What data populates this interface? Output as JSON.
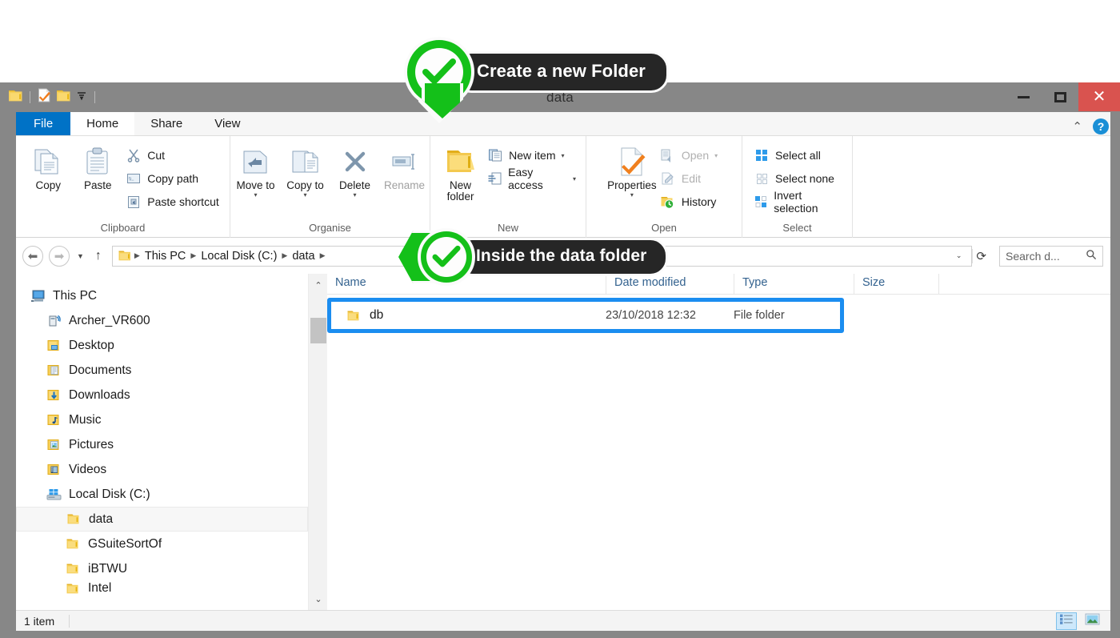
{
  "window": {
    "title": "data",
    "quick_access": [
      "folder-icon",
      "properties-icon",
      "folder-icon",
      "customize-dropdown-icon"
    ],
    "controls": {
      "minimize": "—",
      "maximize": "□",
      "close": "✕"
    }
  },
  "ribbon": {
    "tabs": [
      {
        "label": "File",
        "state": "file"
      },
      {
        "label": "Home",
        "state": "active"
      },
      {
        "label": "Share",
        "state": "normal"
      },
      {
        "label": "View",
        "state": "normal"
      }
    ],
    "collapse_icon": "chevron-up-icon",
    "help_icon": "help-icon",
    "groups": [
      {
        "label": "Clipboard",
        "big_buttons": [
          {
            "label": "Copy",
            "icon": "copy-icon"
          },
          {
            "label": "Paste",
            "icon": "paste-icon"
          }
        ],
        "small_buttons": [
          {
            "label": "Cut",
            "icon": "scissors-icon",
            "disabled": false
          },
          {
            "label": "Copy path",
            "icon": "copy-path-icon",
            "disabled": false
          },
          {
            "label": "Paste shortcut",
            "icon": "paste-shortcut-icon",
            "disabled": false
          }
        ]
      },
      {
        "label": "Organise",
        "big_buttons": [
          {
            "label": "Move to",
            "icon": "move-to-icon",
            "has_caret": true
          },
          {
            "label": "Copy to",
            "icon": "copy-to-icon",
            "has_caret": true
          },
          {
            "label": "Delete",
            "icon": "delete-icon",
            "has_caret": true
          },
          {
            "label": "Rename",
            "icon": "rename-icon",
            "disabled": true
          }
        ],
        "small_buttons": []
      },
      {
        "label": "New",
        "big_buttons": [
          {
            "label": "New folder",
            "icon": "new-folder-icon"
          }
        ],
        "small_buttons": [
          {
            "label": "New item",
            "icon": "new-item-icon",
            "caret": true
          },
          {
            "label": "Easy access",
            "icon": "easy-access-icon",
            "caret": true
          }
        ]
      },
      {
        "label": "Open",
        "big_buttons": [
          {
            "label": "Properties",
            "icon": "properties-icon",
            "has_caret": true
          }
        ],
        "small_buttons": [
          {
            "label": "Open",
            "icon": "open-icon",
            "caret": true,
            "disabled": true
          },
          {
            "label": "Edit",
            "icon": "edit-icon",
            "disabled": true
          },
          {
            "label": "History",
            "icon": "history-icon",
            "disabled": false
          }
        ]
      },
      {
        "label": "Select",
        "big_buttons": [],
        "small_buttons": [
          {
            "label": "Select all",
            "icon": "select-all-icon",
            "disabled": false
          },
          {
            "label": "Select none",
            "icon": "select-none-icon",
            "disabled": false
          },
          {
            "label": "Invert selection",
            "icon": "invert-selection-icon",
            "disabled": false
          }
        ]
      }
    ]
  },
  "address_bar": {
    "back_icon": "back-arrow-icon",
    "forward_icon": "forward-arrow-icon",
    "recent_icon": "chevron-down-icon",
    "up_icon": "up-arrow-icon",
    "breadcrumb_icon": "folder-icon",
    "breadcrumbs": [
      "This PC",
      "Local Disk (C:)",
      "data"
    ],
    "dropdown_icon": "chevron-down-icon",
    "refresh_icon": "refresh-icon",
    "search_placeholder": "Search d...",
    "search_value": "",
    "search_icon": "search-icon"
  },
  "nav_pane": {
    "items": [
      {
        "label": "This PC",
        "icon": "this-pc-icon",
        "depth": 0,
        "selected": false
      },
      {
        "label": "Archer_VR600",
        "icon": "device-icon",
        "depth": 1,
        "selected": false
      },
      {
        "label": "Desktop",
        "icon": "desktop-folder-icon",
        "depth": 1,
        "selected": false
      },
      {
        "label": "Documents",
        "icon": "documents-folder-icon",
        "depth": 1,
        "selected": false
      },
      {
        "label": "Downloads",
        "icon": "downloads-folder-icon",
        "depth": 1,
        "selected": false
      },
      {
        "label": "Music",
        "icon": "music-folder-icon",
        "depth": 1,
        "selected": false
      },
      {
        "label": "Pictures",
        "icon": "pictures-folder-icon",
        "depth": 1,
        "selected": false
      },
      {
        "label": "Videos",
        "icon": "videos-folder-icon",
        "depth": 1,
        "selected": false
      },
      {
        "label": "Local Disk (C:)",
        "icon": "hard-drive-icon",
        "depth": 1,
        "selected": false
      },
      {
        "label": "data",
        "icon": "folder-icon",
        "depth": 2,
        "selected": true
      },
      {
        "label": "GSuiteSortOf",
        "icon": "folder-icon",
        "depth": 2,
        "selected": false
      },
      {
        "label": "iBTWU",
        "icon": "folder-icon",
        "depth": 2,
        "selected": false
      },
      {
        "label": "Intel",
        "icon": "folder-icon",
        "depth": 2,
        "selected": false
      }
    ],
    "scrollbar": {
      "up_icon": "chevron-up-icon",
      "down_icon": "chevron-down-icon"
    }
  },
  "file_list": {
    "columns": [
      "Name",
      "Date modified",
      "Type",
      "Size"
    ],
    "rows": [
      {
        "name": "db",
        "date_modified": "23/10/2018 12:32",
        "type": "File folder",
        "size": "",
        "icon": "folder-icon",
        "selected": true
      }
    ]
  },
  "status_bar": {
    "item_count": "1 item",
    "view_buttons": [
      {
        "name": "details-view-button",
        "icon": "details-view-icon",
        "active": true
      },
      {
        "name": "large-icons-view-button",
        "icon": "large-icons-view-icon",
        "active": false
      }
    ]
  },
  "callouts": [
    {
      "text": "Create a new Folder",
      "direction": "down",
      "check": "check-icon"
    },
    {
      "text": "Inside the data folder",
      "direction": "left",
      "check": "check-icon"
    }
  ],
  "colors": {
    "accent_blue": "#1b8df0",
    "callout_green": "#14c019",
    "callout_dark": "#262626",
    "file_tab_blue": "#0072c6",
    "close_red": "#d9534f",
    "frame_grey": "#878787",
    "column_header_text": "#33628f"
  }
}
